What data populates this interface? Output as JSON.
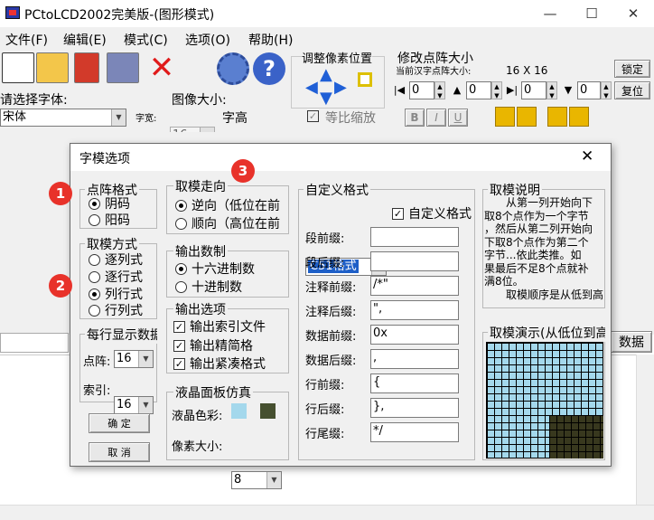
{
  "window": {
    "title": "PCtoLCD2002完美版-(图形模式)",
    "minimize": "—",
    "maximize": "☐",
    "close": "✕"
  },
  "menu": [
    "文件(F)",
    "编辑(E)",
    "模式(C)",
    "选项(O)",
    "帮助(H)"
  ],
  "toolbar": {
    "adjust_label": "调整像素位置",
    "modify_label": "修改点阵大小",
    "current_size_label": "当前汉字点阵大小:",
    "current_size_value": "16 X 16",
    "lock_button": "锁定",
    "reset_button": "复位",
    "spin_values": [
      "0",
      "0",
      "0",
      "0"
    ],
    "font_label": "请选择字体:",
    "font_value": "宋体",
    "image_size_label": "图像大小:",
    "char_width_label": "字宽:",
    "char_width_value": "16",
    "char_height_label": "字高",
    "char_height_value": "16",
    "ratio_label": "等比缩放",
    "style_buttons": [
      "B",
      "I",
      "U"
    ]
  },
  "bg": {
    "data_button": "数据"
  },
  "dialog": {
    "title": "字模选项",
    "close": "✕",
    "dot_format": {
      "title": "点阵格式",
      "options": [
        "阴码",
        "阳码"
      ],
      "selected": 0
    },
    "mode": {
      "title": "取模方式",
      "options": [
        "逐列式",
        "逐行式",
        "列行式",
        "行列式"
      ],
      "selected": 2
    },
    "per_line": {
      "title": "每行显示数据",
      "dot_label": "点阵:",
      "dot_value": "16",
      "index_label": "索引:",
      "index_value": "16"
    },
    "ok_button": "确  定",
    "cancel_button": "取  消",
    "direction": {
      "title": "取模走向",
      "options": [
        "逆向（低位在前",
        "顺向（高位在前"
      ],
      "selected": 0
    },
    "number_system": {
      "title": "输出数制",
      "options": [
        "十六进制数",
        "十进制数"
      ],
      "selected": 0
    },
    "output_options": {
      "title": "输出选项",
      "items": [
        "输出索引文件",
        "输出精简格",
        "输出紧凑格式"
      ],
      "checked": [
        true,
        true,
        true
      ]
    },
    "lcd": {
      "title": "液晶面板仿真",
      "color_label": "液晶色彩:",
      "pixel_label": "像素大小:",
      "pixel_value": "8",
      "screen_color": "#a4d8ec",
      "dot_color": "#465030"
    },
    "custom": {
      "title": "自定义格式",
      "format_value": "C51格式",
      "custom_check": "自定义格式",
      "fields": [
        {
          "label": "段前缀:",
          "value": ""
        },
        {
          "label": "段后缀:",
          "value": ""
        },
        {
          "label": "注释前缀:",
          "value": "/*\""
        },
        {
          "label": "注释后缀:",
          "value": "\","
        },
        {
          "label": "数据前缀:",
          "value": "0x"
        },
        {
          "label": "数据后缀:",
          "value": ","
        },
        {
          "label": "行前缀:",
          "value": "{"
        },
        {
          "label": "行后缀:",
          "value": "},"
        },
        {
          "label": "行尾缀:",
          "value": "*/"
        }
      ]
    },
    "explain": {
      "title": "取模说明",
      "lines": [
        "从第一列开始向下",
        "取8个点作为一个字节",
        "，然后从第二列开始向",
        "下取8个点作为第二个",
        "字节...依此类推。如",
        "果最后不足8个点就补",
        "满8位。",
        "取模顺序是从低到高"
      ]
    },
    "demo": {
      "title": "取模演示(从低位到高位"
    }
  },
  "annotations": [
    "1",
    "2",
    "3"
  ]
}
